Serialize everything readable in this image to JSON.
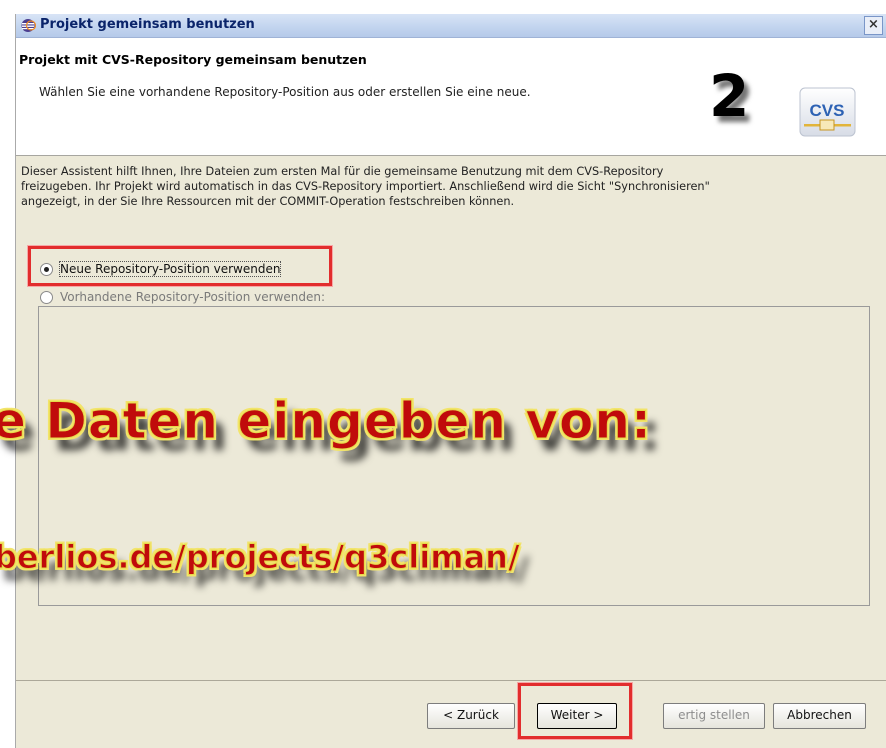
{
  "window": {
    "title": "Projekt gemeinsam benutzen",
    "close_label": "×"
  },
  "banner": {
    "title": "Projekt mit CVS-Repository gemeinsam benutzen",
    "description": "Wählen Sie eine vorhandene Repository-Position aus oder erstellen Sie eine neue.",
    "step_number": "2",
    "logo_text": "CVS"
  },
  "intro": {
    "line1": "Dieser Assistent hilft Ihnen, Ihre Dateien zum ersten Mal für die gemeinsame Benutzung mit dem CVS-Repository",
    "line2": "freizugeben. Ihr Projekt wird automatisch in das CVS-Repository importiert. Anschließend wird die Sicht \"Synchronisieren\"",
    "line3": "angezeigt, in der Sie Ihre Ressourcen mit der COMMIT-Operation festschreiben können."
  },
  "options": {
    "new_location": "Neue Repository-Position verwenden",
    "existing_location": "Vorhandene Repository-Position verwenden:"
  },
  "overlay": {
    "line1": "e Daten eingeben von:",
    "line2": "berlios.de/projects/q3climan/"
  },
  "buttons": {
    "back": "< Zurück",
    "next": "Weiter >",
    "finish": "ertig stellen",
    "cancel": "Abbrechen"
  },
  "colors": {
    "highlight_border": "#e22d2d",
    "overlay_text": "#c00b0b",
    "overlay_outline": "#f2e46a",
    "dialog_bg": "#ece9d8"
  }
}
